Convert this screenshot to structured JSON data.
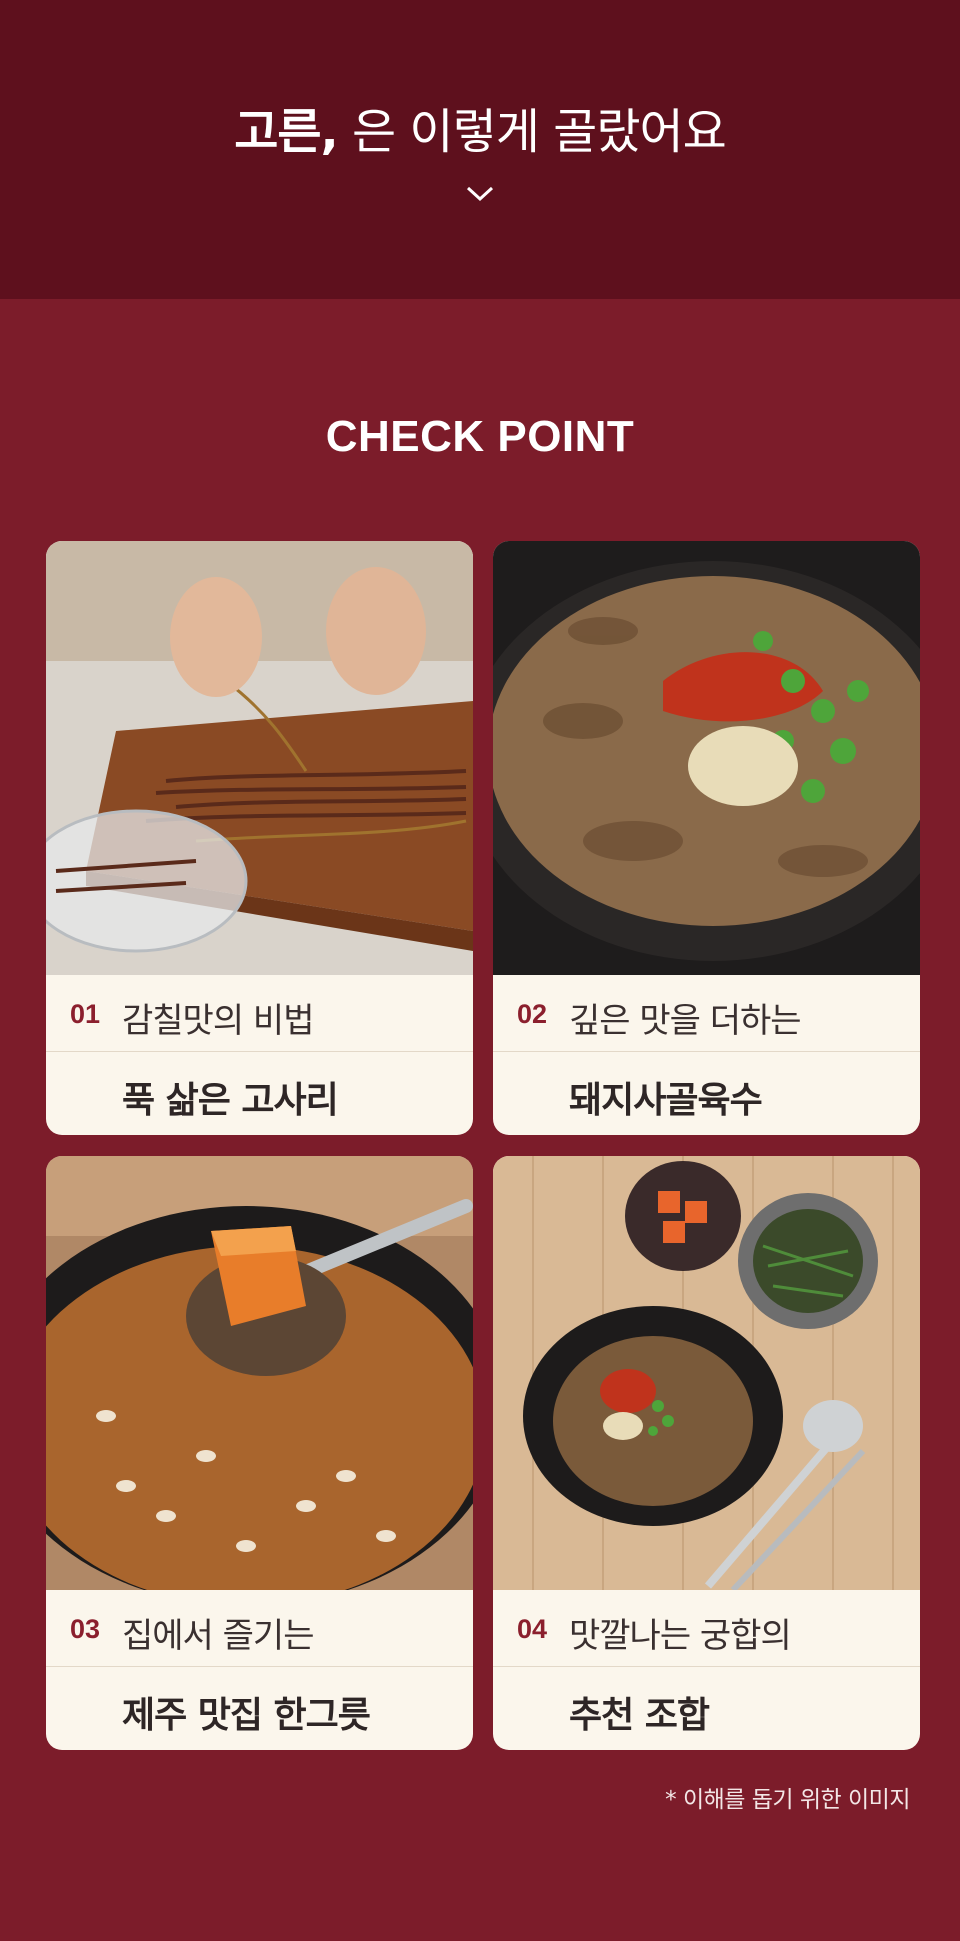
{
  "header": {
    "brand": "고른,",
    "title_rest": " 은 이렇게 골랐어요"
  },
  "section_title": "CHECK POINT",
  "cards": [
    {
      "num": "01",
      "sub": "감칠맛의 비법",
      "main": "푹 삶은 고사리",
      "image": "fern-preparation-photo"
    },
    {
      "num": "02",
      "sub": "깊은 맛을 더하는",
      "main": "돼지사골육수",
      "image": "soup-bowl-photo"
    },
    {
      "num": "03",
      "sub": "집에서 즐기는",
      "main": "제주 맛집 한그릇",
      "image": "spoon-with-kimchi-photo"
    },
    {
      "num": "04",
      "sub": "맛깔나는 궁합의",
      "main": "추천 조합",
      "image": "table-setting-photo"
    }
  ],
  "footnote": "* 이해를 돕기 위한 이미지",
  "colors": {
    "header_bg": "#5e101d",
    "body_bg": "#7c1c2a",
    "card_bg": "#fbf6ec",
    "number_accent": "#8b1f2d"
  }
}
